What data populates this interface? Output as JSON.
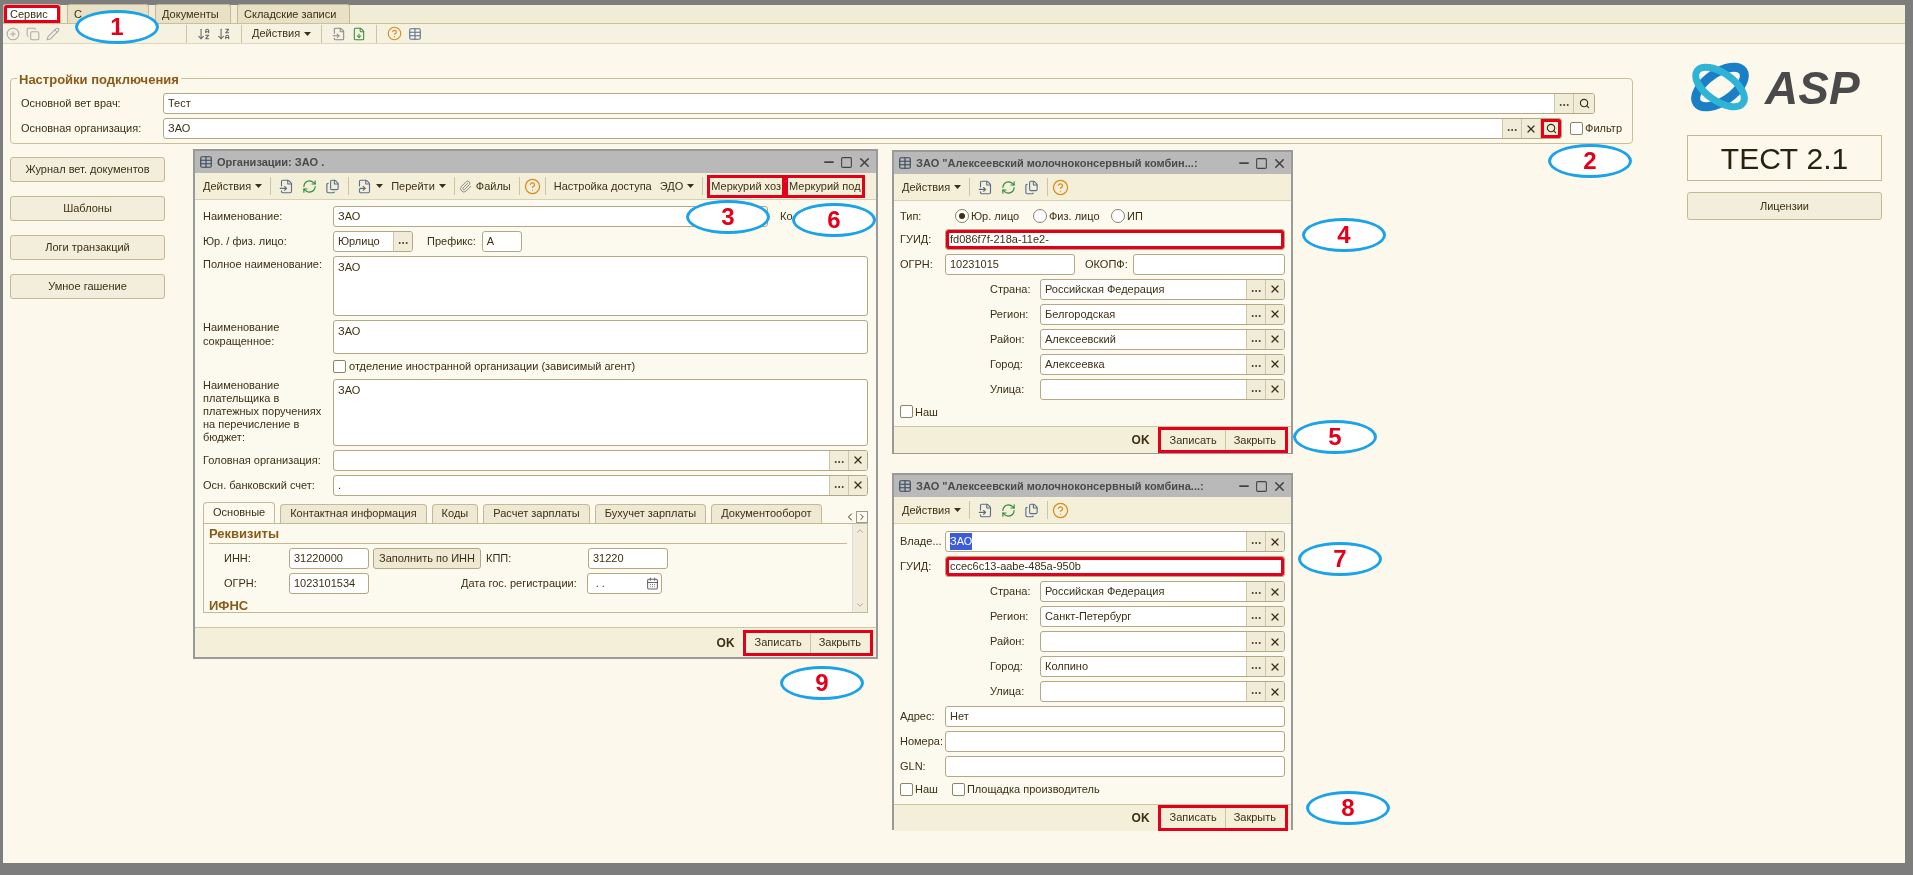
{
  "tabs": [
    {
      "label": "Сервис",
      "selected": true,
      "highlighted": true
    },
    {
      "label": "С",
      "selected": false,
      "highlighted": false
    },
    {
      "label": "Документы",
      "selected": false,
      "highlighted": false
    },
    {
      "label": "Складские записи",
      "selected": false,
      "highlighted": false
    }
  ],
  "main_toolbar": {
    "actions": "Действия"
  },
  "settings": {
    "title": "Настройки подключения",
    "vet_label": "Основной вет врач:",
    "vet_value": "Тест",
    "org_label": "Основная организация:",
    "org_value": "ЗАО",
    "search_highlighted": true,
    "filter_label": "Фильтр",
    "filter_checked": false
  },
  "side_buttons": [
    "Журнал вет. документов",
    "Шаблоны",
    "Логи транзакций",
    "Умное гашение"
  ],
  "brand": {
    "logo": "ASP",
    "version": "ТЕСТ 2.1",
    "licenses": "Лицензии"
  },
  "org_window": {
    "title": "Организации: ЗАО  .",
    "toolbar": [
      {
        "kind": "menu",
        "label": "Действия",
        "highlighted": false
      },
      {
        "kind": "doc_icons"
      },
      {
        "kind": "goto",
        "label": "Перейти",
        "highlighted": false
      },
      {
        "kind": "files",
        "label": "Файлы",
        "highlighted": false
      },
      {
        "kind": "help"
      },
      {
        "kind": "button",
        "label": "Настройка доступа",
        "highlighted": false
      },
      {
        "kind": "menu",
        "label": "ЭДО",
        "highlighted": false
      },
      {
        "kind": "button",
        "label": "Меркурий хоз",
        "highlighted": true
      },
      {
        "kind": "button",
        "label": "Меркурий под",
        "highlighted": true
      }
    ],
    "fields": {
      "name_label": "Наименование:",
      "name_value": "ЗАО",
      "code_label": "Ко",
      "type_label": "Юр. / физ. лицо:",
      "type_value": "Юрлицо",
      "prefix_label": "Префикс:",
      "prefix_value": "А",
      "full_label": "Полное наименование:",
      "full_value": "ЗАО",
      "short_label": "Наименование сокращенное:",
      "short_value": "ЗАО",
      "branch_label": "отделение иностранной организации (зависимый агент)",
      "branch_checked": false,
      "payer_label": "Наименование плательщика в платежных поручениях на перечисление в бюджет:",
      "payer_value": "ЗАО",
      "head_label": "Головная организация:",
      "bank_label": "Осн. банковский счет:",
      "bank_value": "."
    },
    "tabs": [
      {
        "label": "Основные",
        "selected": true
      },
      {
        "label": "Контактная информация",
        "selected": false
      },
      {
        "label": "Коды",
        "selected": false
      },
      {
        "label": "Расчет зарплаты",
        "selected": false
      },
      {
        "label": "Бухучет зарплаты",
        "selected": false
      },
      {
        "label": "Документооборот",
        "selected": false
      }
    ],
    "requisites": {
      "title": "Реквизиты",
      "inn_label": "ИНН:",
      "inn_value": "31220000",
      "fill_button": "Заполнить по ИНН",
      "kpp_label": "КПП:",
      "kpp_value": "31220",
      "ogrn_label": "ОГРН:",
      "ogrn_value": "1023101534",
      "date_label": "Дата гос. регистрации:",
      "date_value": ". ."
    },
    "ifns_title": "ИФНС",
    "footer": {
      "ok": "OK",
      "save": "Записать",
      "close": "Закрыть",
      "highlighted": true
    }
  },
  "contractor_windows": [
    {
      "title": "ЗАО \"Алексеевский молочноконсервный комбин...:",
      "actions": "Действия",
      "rows": [
        {
          "kind": "type",
          "label": "Тип:",
          "options": [
            {
              "label": "Юр. лицо",
              "selected": true
            },
            {
              "label": "Физ. лицо",
              "selected": false
            },
            {
              "label": "ИП",
              "selected": false
            }
          ]
        },
        {
          "kind": "field",
          "label": "ГУИД:",
          "value": "fd086f7f-218a-11e2-",
          "highlighted": true
        },
        {
          "kind": "pair",
          "label": "ОГРН:",
          "value": "10231015",
          "label2": "ОКОПФ:"
        },
        {
          "kind": "ref",
          "label": "Страна:",
          "value": "Российская Федерация"
        },
        {
          "kind": "ref",
          "label": "Регион:",
          "value": "Белгородская"
        },
        {
          "kind": "ref",
          "label": "Район:",
          "value": "Алексеевский"
        },
        {
          "kind": "ref",
          "label": "Город:",
          "value": "Алексеевка"
        },
        {
          "kind": "ref",
          "label": "Улица:"
        },
        {
          "kind": "checks",
          "items": [
            {
              "label": "Наш",
              "checked": false
            }
          ]
        }
      ],
      "footer": {
        "ok": "OK",
        "save": "Записать",
        "close": "Закрыть",
        "highlighted": true
      }
    },
    {
      "title": "ЗАО \"Алексеевский молочноконсервный комбина...:",
      "actions": "Действия",
      "rows": [
        {
          "kind": "owner",
          "label": "Владе...",
          "value": "ЗАО",
          "value_selected": true
        },
        {
          "kind": "field",
          "label": "ГУИД:",
          "value": "ccec6c13-aabe-485a-950b",
          "highlighted": true
        },
        {
          "kind": "ref",
          "label": "Страна:",
          "value": "Российская Федерация"
        },
        {
          "kind": "ref",
          "label": "Регион:",
          "value": "Санкт-Петербург"
        },
        {
          "kind": "ref",
          "label": "Район:"
        },
        {
          "kind": "ref",
          "label": "Город:",
          "value": "Колпино"
        },
        {
          "kind": "ref",
          "label": "Улица:"
        },
        {
          "kind": "field",
          "label": "Адрес:",
          "value": "Нет",
          "highlighted": false
        },
        {
          "kind": "field",
          "label": "Номера:",
          "highlighted": false
        },
        {
          "kind": "field",
          "label": "GLN:",
          "highlighted": false
        },
        {
          "kind": "checks",
          "items": [
            {
              "label": "Наш",
              "checked": false
            },
            {
              "label": "Площадка производитель",
              "checked": false
            }
          ]
        }
      ],
      "footer": {
        "ok": "OK",
        "save": "Записать",
        "close": "Закрыть",
        "highlighted": true
      }
    }
  ],
  "callouts": [
    "1",
    "2",
    "3",
    "4",
    "5",
    "6",
    "7",
    "8",
    "9"
  ]
}
